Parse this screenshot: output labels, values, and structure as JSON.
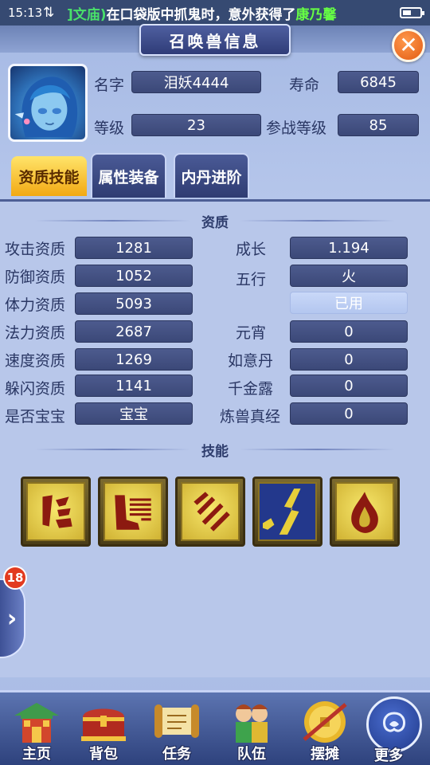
{
  "status": {
    "time": "15:13",
    "ticker_part1": "]文庙)",
    "ticker_part2": "在口袋版中抓鬼时，意外获得了",
    "ticker_part3": "康乃馨"
  },
  "header": {
    "title": "召唤兽信息"
  },
  "pet": {
    "name_label": "名字",
    "name": "泪妖4444",
    "life_label": "寿命",
    "life": "6845",
    "level_label": "等级",
    "level": "23",
    "battle_level_label": "参战等级",
    "battle_level": "85"
  },
  "tabs": [
    {
      "label": "资质技能",
      "active": true
    },
    {
      "label": "属性装备",
      "active": false
    },
    {
      "label": "内丹进阶",
      "active": false
    }
  ],
  "aptitude": {
    "section_title": "资质",
    "left": [
      {
        "label": "攻击资质",
        "value": "1281"
      },
      {
        "label": "防御资质",
        "value": "1052"
      },
      {
        "label": "体力资质",
        "value": "5093"
      },
      {
        "label": "法力资质",
        "value": "2687"
      },
      {
        "label": "速度资质",
        "value": "1269"
      },
      {
        "label": "躲闪资质",
        "value": "1141"
      },
      {
        "label": "是否宝宝",
        "value": "宝宝"
      }
    ],
    "right": [
      {
        "label": "成长",
        "value": "1.194"
      },
      {
        "label": "五行",
        "value": "火"
      },
      {
        "label": "",
        "value": "已用"
      },
      {
        "label": "元宵",
        "value": "0"
      },
      {
        "label": "如意丹",
        "value": "0"
      },
      {
        "label": "千金露",
        "value": "0"
      },
      {
        "label": "炼兽真经",
        "value": "0"
      }
    ]
  },
  "skills": {
    "section_title": "技能",
    "icons": [
      "skill-rune-icon",
      "skill-boots-icon",
      "skill-claw-icon",
      "skill-lightning-icon",
      "skill-flame-icon"
    ]
  },
  "side": {
    "badge_count": "18"
  },
  "bottom_nav": [
    {
      "label": "主页",
      "icon": "palace-icon"
    },
    {
      "label": "背包",
      "icon": "chest-icon"
    },
    {
      "label": "任务",
      "icon": "scroll-icon"
    },
    {
      "label": "队伍",
      "icon": "team-icon"
    },
    {
      "label": "摆摊",
      "icon": "coin-icon"
    },
    {
      "label": "更多",
      "icon": "more-icon"
    }
  ],
  "colors": {
    "field_bg": "#3b4878",
    "active_tab": "#f2a914",
    "close_button": "#e25a12",
    "skill_gold": "#d0b233"
  }
}
